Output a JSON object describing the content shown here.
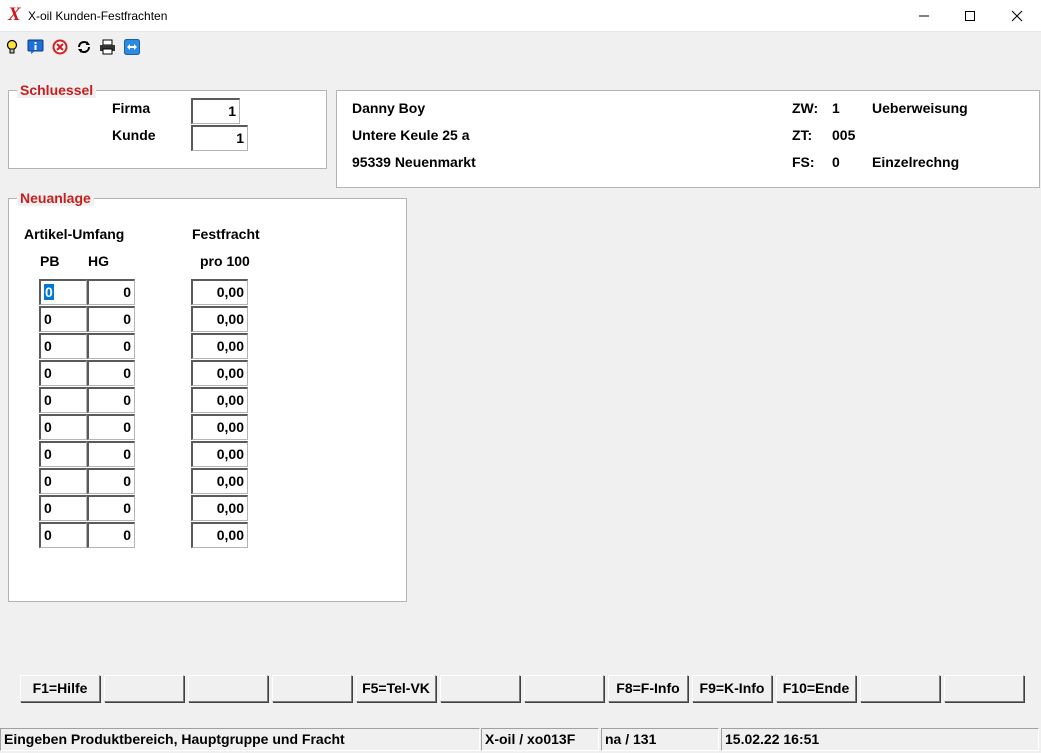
{
  "window": {
    "title": "X-oil Kunden-Festfrachten",
    "logo_letter": "X",
    "minimize_icon": "minimize-icon",
    "maximize_icon": "maximize-icon",
    "close_icon": "close-icon"
  },
  "toolbar": {
    "icons": [
      "lightbulb-icon",
      "info-icon",
      "cancel-icon",
      "refresh-icon",
      "printer-icon",
      "remote-support-icon"
    ]
  },
  "schluessel": {
    "legend": "Schluessel",
    "firma_label": "Firma",
    "firma_value": "1",
    "kunde_label": "Kunde",
    "kunde_value": "1"
  },
  "customer": {
    "name": "Danny Boy",
    "street": "Untere Keule 25 a",
    "city": "95339  Neuenmarkt",
    "zw_label": "ZW:",
    "zw_value": "1",
    "zw_text": "Ueberweisung",
    "zt_label": "ZT:",
    "zt_value": "005",
    "fs_label": "FS:",
    "fs_value": "0",
    "fs_text": "Einzelrechng"
  },
  "neuanlage": {
    "legend": "Neuanlage",
    "col_artikel": "Artikel-Umfang",
    "col_festfracht": "Festfracht",
    "col_pb": "PB",
    "col_hg": "HG",
    "col_pro100": "pro 100",
    "rows": [
      {
        "pb": "0",
        "hg": "0",
        "fracht": "0,00"
      },
      {
        "pb": "0",
        "hg": "0",
        "fracht": "0,00"
      },
      {
        "pb": "0",
        "hg": "0",
        "fracht": "0,00"
      },
      {
        "pb": "0",
        "hg": "0",
        "fracht": "0,00"
      },
      {
        "pb": "0",
        "hg": "0",
        "fracht": "0,00"
      },
      {
        "pb": "0",
        "hg": "0",
        "fracht": "0,00"
      },
      {
        "pb": "0",
        "hg": "0",
        "fracht": "0,00"
      },
      {
        "pb": "0",
        "hg": "0",
        "fracht": "0,00"
      },
      {
        "pb": "0",
        "hg": "0",
        "fracht": "0,00"
      },
      {
        "pb": "0",
        "hg": "0",
        "fracht": "0,00"
      }
    ]
  },
  "function_keys": [
    "F1=Hilfe",
    "",
    "",
    "",
    "F5=Tel-VK",
    "",
    "",
    "F8=F-Info",
    "F9=K-Info",
    "F10=Ende",
    "",
    ""
  ],
  "status": {
    "message": "Eingeben Produktbereich, Hauptgruppe und Fracht",
    "program": "X-oil / xo013F",
    "user": "na / 131",
    "datetime": "15.02.22 16:51"
  },
  "colors": {
    "legend_red": "#c81e1e",
    "logo_red": "#d4141b",
    "selection_blue": "#0078d7"
  }
}
